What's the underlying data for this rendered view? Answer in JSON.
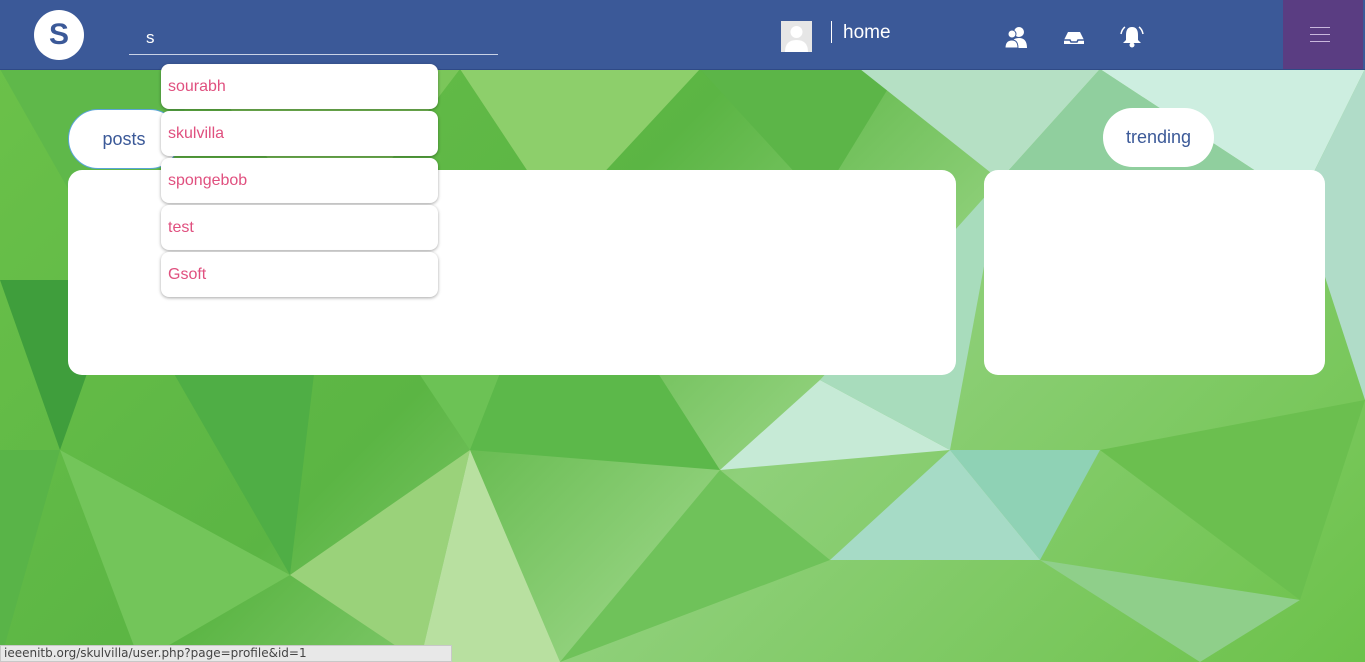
{
  "navbar": {
    "logo_letter": "S",
    "search_value": "s",
    "home_label": "home",
    "accent_color": "#3b5998",
    "icons": [
      "friends-icon",
      "inbox-icon",
      "notifications-bell-icon",
      "hamburger-menu-icon"
    ]
  },
  "search_suggestions": [
    {
      "label": "sourabh"
    },
    {
      "label": "skulvilla"
    },
    {
      "label": "spongebob"
    },
    {
      "label": "test"
    },
    {
      "label": "Gsoft"
    }
  ],
  "main": {
    "posts_label": "posts",
    "trending_label": "trending"
  },
  "status_url": "ieeenitb.org/skulvilla/user.php?page=profile&id=1"
}
